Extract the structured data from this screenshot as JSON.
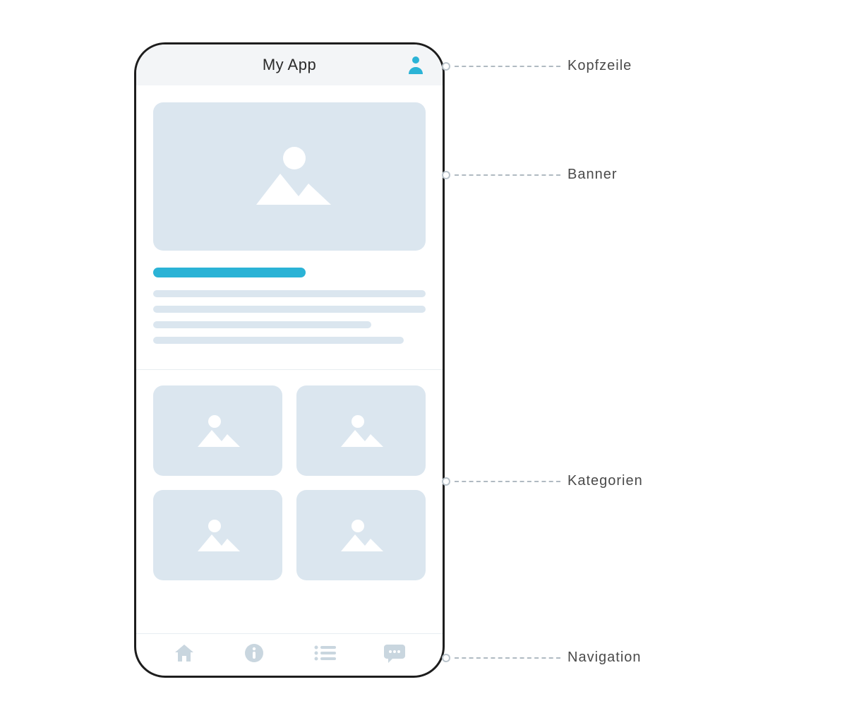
{
  "header": {
    "title": "My App",
    "profile_icon": "user-icon"
  },
  "annotations": {
    "header_label": "Kopfzeile",
    "banner_label": "Banner",
    "categories_label": "Kategorien",
    "navigation_label": "Navigation"
  },
  "colors": {
    "accent": "#2bb3d6",
    "placeholder": "#dbe6ef",
    "frame": "#1d1d1d"
  },
  "bottom_nav": {
    "items": [
      {
        "icon": "home-icon"
      },
      {
        "icon": "info-icon"
      },
      {
        "icon": "list-icon"
      },
      {
        "icon": "chat-icon"
      }
    ]
  }
}
